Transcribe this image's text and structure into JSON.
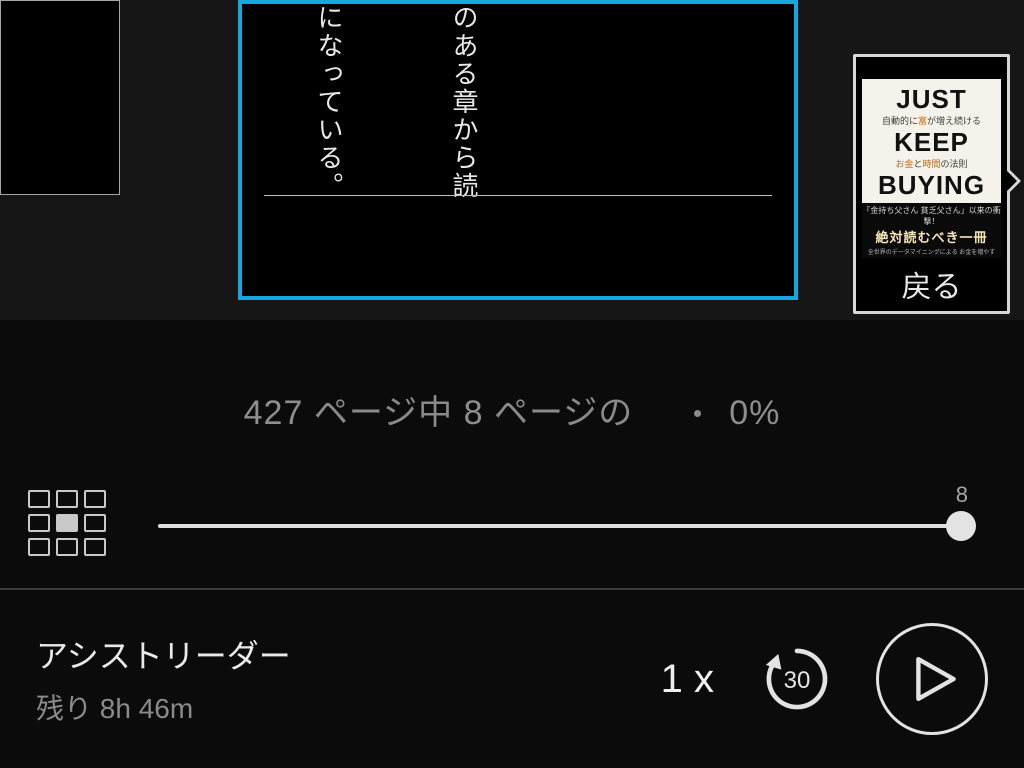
{
  "reader": {
    "col1": "のある章から読",
    "col2": "になっている。"
  },
  "cover": {
    "title1": "JUST",
    "sub1_a": "自動的に",
    "sub1_b": "富",
    "sub1_c": "が増え続ける",
    "title2": "KEEP",
    "sub2_a": "お金",
    "sub2_b": "と",
    "sub2_c": "時間",
    "sub2_d": "の法則",
    "title3": "BUYING",
    "obi_small": "「金持ち父さん 貧乏父さん」以来の衝撃！",
    "obi_main": "絶対読むべき一冊",
    "obi_foot": "全世界のデータマイニングによる お金を増やす",
    "back": "戻る"
  },
  "progress": {
    "total_pages": "427",
    "label_mid1": " ページ中 ",
    "current_page": "8",
    "label_mid2": " ページの",
    "percent": "0%"
  },
  "slider": {
    "tick": "8"
  },
  "bottom": {
    "mode": "アシストリーダー",
    "remaining_prefix": "残り ",
    "remaining_time": "8h 46m",
    "speed_value": "1",
    "speed_suffix": " x",
    "skip_seconds": "30"
  }
}
